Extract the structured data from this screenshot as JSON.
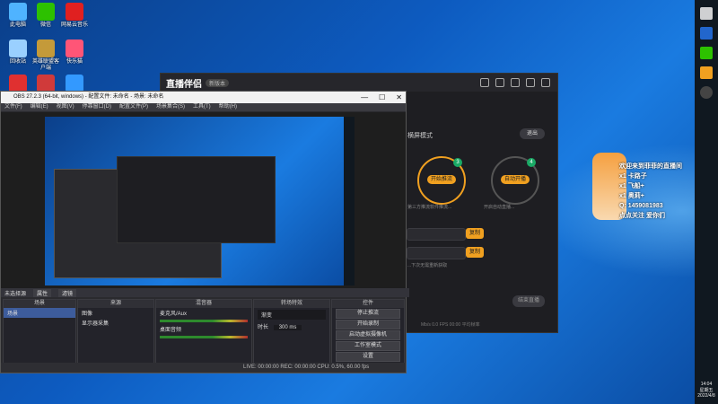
{
  "colors": {
    "accent": "#f0a020",
    "obs_bg": "#2a2a2e",
    "green": "#1aaa66"
  },
  "desktop_icons": [
    {
      "label": "此电脑",
      "color": "#4fb3ff"
    },
    {
      "label": "微信",
      "color": "#2dc100"
    },
    {
      "label": "网易云音乐",
      "color": "#e02020"
    },
    {
      "label": "回收站",
      "color": "#9ad0ff"
    },
    {
      "label": "英雄联盟客户端",
      "color": "#c49a3a"
    },
    {
      "label": "快乐猫",
      "color": "#ff5577"
    },
    {
      "label": "",
      "color": "#e03030"
    },
    {
      "label": "",
      "color": "#d03a3a"
    },
    {
      "label": "",
      "color": "#3399ff"
    }
  ],
  "live_app": {
    "logo": "直播伴侣",
    "version": "新版本",
    "mode_text": "横屏模式",
    "exit_label": "退出",
    "node_start": "开始推流",
    "node_auto": "自动开播",
    "node_start_desc": "第三方推流软件推流...",
    "node_auto_desc": "开启自动直播...",
    "copy_label": "复制",
    "hint": "...下次无需重新获取",
    "stop_label": "结束直播",
    "stats": "Mb/s 0.0  FPS 00:00  平均帧率"
  },
  "obs": {
    "title": "OBS 27.2.3 (64-bit, windows) - 配置文件: 未命名 - 场景: 未命名",
    "menu": [
      "文件(F)",
      "编辑(E)",
      "视图(V)",
      "停靠窗口(D)",
      "配置文件(P)",
      "场景集合(S)",
      "工具(T)",
      "帮助(H)"
    ],
    "subbar": {
      "label": "未选择源",
      "properties": "属性",
      "filters": "滤镜"
    },
    "docks": {
      "scenes": {
        "title": "场景",
        "items": [
          "场景"
        ]
      },
      "sources": {
        "title": "来源",
        "items": [
          "图像",
          "显示器采集"
        ]
      },
      "mixer": {
        "title": "混音器",
        "items": [
          {
            "name": "麦克风/Aux",
            "db": "0.0 dB"
          },
          {
            "name": "桌面音频",
            "db": "0.0 dB"
          }
        ]
      },
      "transitions": {
        "title": "转场特效",
        "type": "渐变",
        "duration_label": "时长",
        "duration": "300 ms"
      },
      "controls": {
        "title": "控件",
        "buttons": [
          "停止推流",
          "开始录制",
          "启动虚拟摄像机",
          "工作室模式",
          "设置",
          "退出"
        ]
      }
    },
    "status": "LIVE: 00:00:00   REC: 00:00:00   CPU: 0.5%, 60.00 fps"
  },
  "overlay": {
    "lines": [
      "欢迎来到菲菲的直播间",
      "x1 卡路子",
      "x1 飞船+",
      "x1 奥莉+",
      "Q: 1459081983",
      "点点关注 爱你们"
    ]
  },
  "taskbar": {
    "time": "14:04",
    "weekday": "星期五",
    "date": "2022/4/8"
  }
}
